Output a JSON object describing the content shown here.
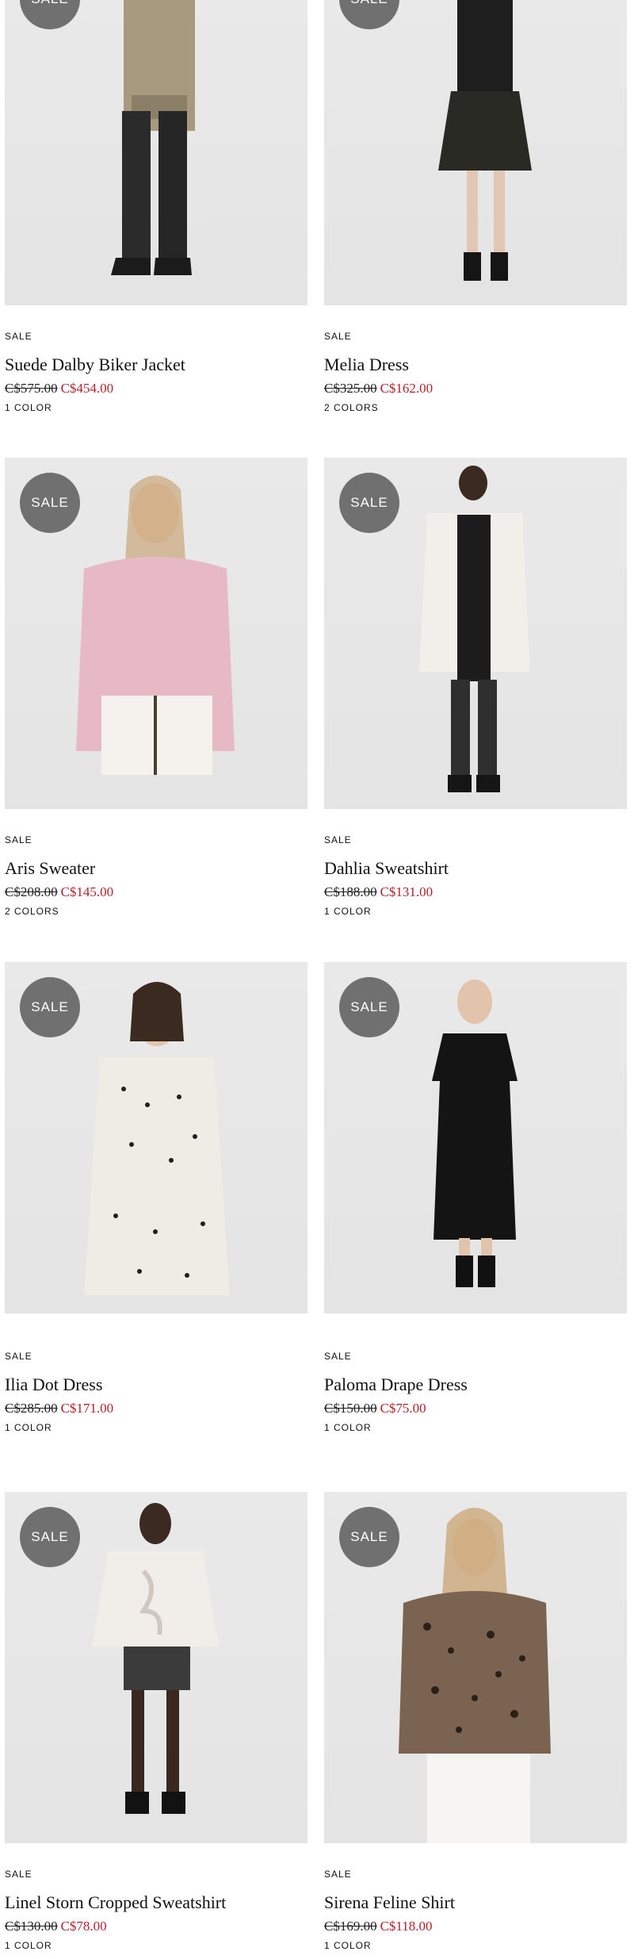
{
  "products": [
    {
      "tag": "SALE",
      "badge": "SALE",
      "name": "Suede Dalby Biker Jacket",
      "old_price": "C$575.00",
      "new_price": "C$454.00",
      "colors": "1 COLOR"
    },
    {
      "tag": "SALE",
      "badge": "SALE",
      "name": "Melia Dress",
      "old_price": "C$325.00",
      "new_price": "C$162.00",
      "colors": "2 COLORS"
    },
    {
      "tag": "SALE",
      "badge": "SALE",
      "name": "Aris Sweater",
      "old_price": "C$208.00",
      "new_price": "C$145.00",
      "colors": "2 COLORS"
    },
    {
      "tag": "SALE",
      "badge": "SALE",
      "name": "Dahlia Sweatshirt",
      "old_price": "C$188.00",
      "new_price": "C$131.00",
      "colors": "1 COLOR"
    },
    {
      "tag": "SALE",
      "badge": "SALE",
      "name": "Ilia Dot Dress",
      "old_price": "C$285.00",
      "new_price": "C$171.00",
      "colors": "1 COLOR"
    },
    {
      "tag": "SALE",
      "badge": "SALE",
      "name": "Paloma Drape Dress",
      "old_price": "C$150.00",
      "new_price": "C$75.00",
      "colors": "1 COLOR"
    },
    {
      "tag": "SALE",
      "badge": "SALE",
      "name": "Linel Storn Cropped Sweatshirt",
      "old_price": "C$130.00",
      "new_price": "C$78.00",
      "colors": "1 COLOR"
    },
    {
      "tag": "SALE",
      "badge": "SALE",
      "name": "Sirena Feline Shirt",
      "old_price": "C$169.00",
      "new_price": "C$118.00",
      "colors": "1 COLOR"
    }
  ],
  "colors": {
    "sale_price": "#b3222a",
    "badge": "#707070",
    "photo_bg": "#e6e6e6"
  }
}
